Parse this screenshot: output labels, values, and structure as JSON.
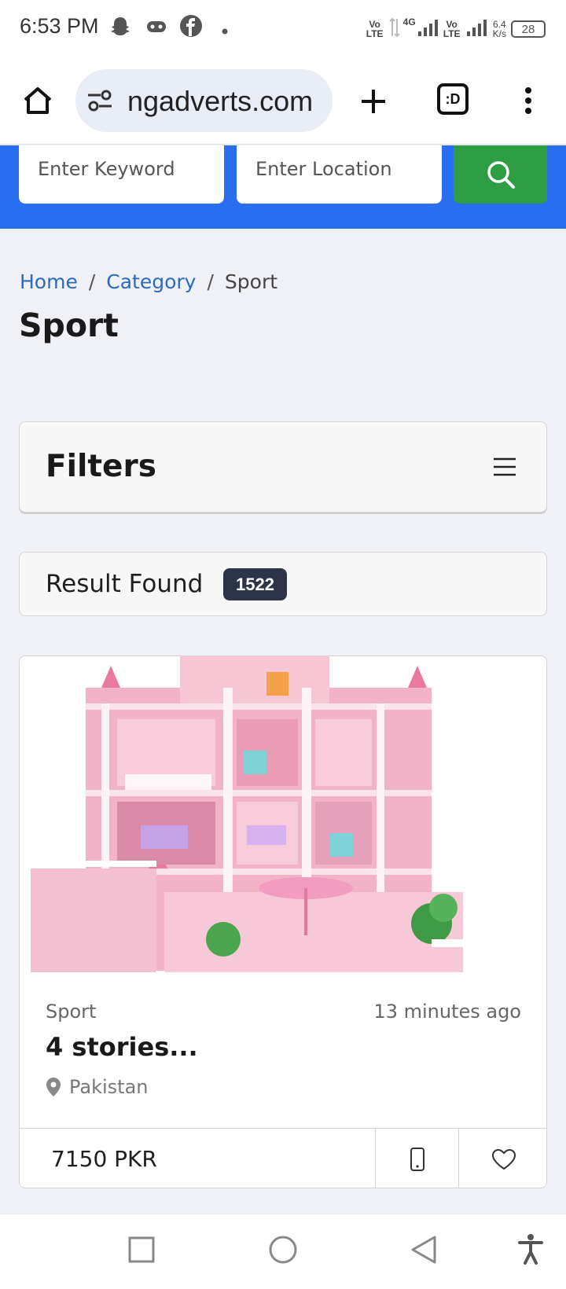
{
  "status_bar": {
    "time": "6:53 PM",
    "icons": [
      "snapchat-icon",
      "gamepad-icon",
      "facebook-icon",
      "dot-icon"
    ],
    "network_left": "Vo LTE",
    "network_mid": "4G",
    "network_right": "Vo LTE",
    "speed": "6.4",
    "speed_unit": "K/s",
    "battery": "28"
  },
  "browser": {
    "url": "ngadverts.com",
    "tab_label": ":D",
    "icons": [
      "home-icon",
      "site-settings-icon",
      "new-tab-icon",
      "tab-switcher-icon",
      "overflow-menu-icon"
    ]
  },
  "search": {
    "keyword_placeholder": "Enter Keyword",
    "location_placeholder": "Enter Location",
    "button_icon": "search-icon",
    "button_color": "#2e9e45",
    "band_color": "#2a6ef0"
  },
  "breadcrumb": {
    "home": "Home",
    "category": "Category",
    "current": "Sport",
    "separator": "/"
  },
  "page_title": "Sport",
  "filters": {
    "title": "Filters",
    "icon": "hamburger-menu-icon"
  },
  "results": {
    "label": "Result Found",
    "count": "1522"
  },
  "listing": {
    "category": "Sport",
    "time": "13 minutes ago",
    "title": "4 stories...",
    "location": "Pakistan",
    "price": "7150 PKR",
    "image": "pink-dollhouse-image",
    "actions": [
      "phone-icon",
      "heart-icon"
    ]
  },
  "nav_bar": {
    "buttons": [
      "recents-square-icon",
      "home-circle-icon",
      "back-triangle-icon",
      "accessibility-icon"
    ]
  }
}
